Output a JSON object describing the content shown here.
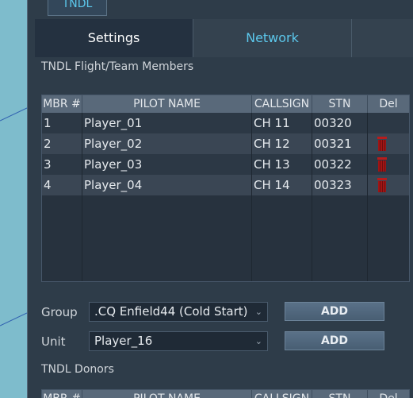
{
  "window": {
    "tab_label": "TNDL"
  },
  "subtabs": [
    {
      "label": "Settings"
    },
    {
      "label": "Network"
    }
  ],
  "members": {
    "section_title": "TNDL Flight/Team Members",
    "columns": [
      "MBR #",
      "PILOT NAME",
      "CALLSIGN",
      "STN",
      "Del"
    ],
    "rows": [
      {
        "mbr": "1",
        "name": "Player_01",
        "callsign": "CH 11",
        "stn": "00320",
        "deletable": false
      },
      {
        "mbr": "2",
        "name": "Player_02",
        "callsign": "CH 12",
        "stn": "00321",
        "deletable": true
      },
      {
        "mbr": "3",
        "name": "Player_03",
        "callsign": "CH 13",
        "stn": "00322",
        "deletable": true
      },
      {
        "mbr": "4",
        "name": "Player_04",
        "callsign": "CH 14",
        "stn": "00323",
        "deletable": true
      }
    ]
  },
  "form": {
    "group_label": "Group",
    "group_value": ".CQ Enfield44 (Cold Start)",
    "unit_label": "Unit",
    "unit_value": "Player_16",
    "add_label": "ADD"
  },
  "donors": {
    "section_title": "TNDL Donors",
    "columns": [
      "MBR #",
      "PILOT NAME",
      "CALLSIGN",
      "STN",
      "Del"
    ]
  },
  "icons": {
    "delete": "trash-icon",
    "dropdown": "chevron-down-icon"
  },
  "colors": {
    "accent": "#5cc8ec",
    "delete": "#b81c1c",
    "panel": "#2e3c49"
  }
}
